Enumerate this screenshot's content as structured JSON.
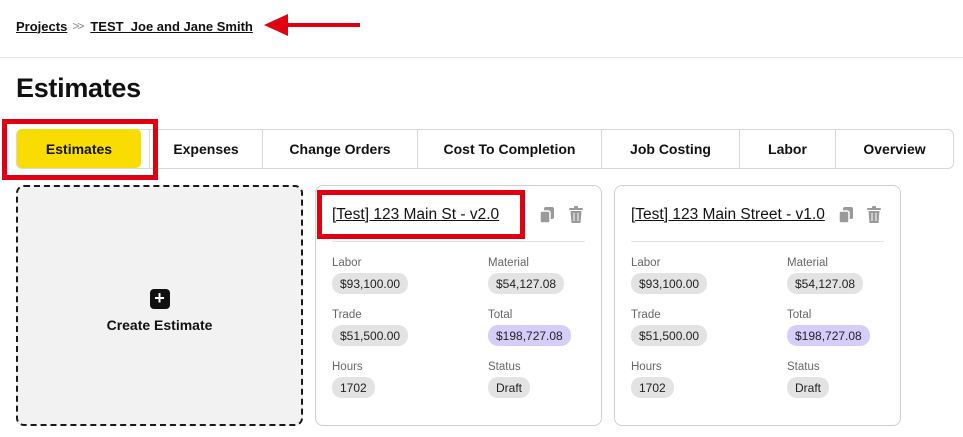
{
  "breadcrumb": {
    "root": "Projects",
    "separator": ">>",
    "current": "TEST_Joe and Jane Smith"
  },
  "page": {
    "title": "Estimates"
  },
  "tabs": [
    {
      "label": "Estimates",
      "active": true
    },
    {
      "label": "Expenses"
    },
    {
      "label": "Change Orders"
    },
    {
      "label": "Cost To Completion"
    },
    {
      "label": "Job Costing"
    },
    {
      "label": "Labor"
    },
    {
      "label": "Overview"
    }
  ],
  "create": {
    "label": "Create Estimate",
    "icon": "plus-icon"
  },
  "estimates": [
    {
      "title": "[Test] 123 Main St - v2.0",
      "labor_label": "Labor",
      "labor": "$93,100.00",
      "material_label": "Material",
      "material": "$54,127.08",
      "trade_label": "Trade",
      "trade": "$51,500.00",
      "total_label": "Total",
      "total": "$198,727.08",
      "hours_label": "Hours",
      "hours": "1702",
      "status_label": "Status",
      "status": "Draft"
    },
    {
      "title": "[Test] 123 Main Street - v1.0",
      "labor_label": "Labor",
      "labor": "$93,100.00",
      "material_label": "Material",
      "material": "$54,127.08",
      "trade_label": "Trade",
      "trade": "$51,500.00",
      "total_label": "Total",
      "total": "$198,727.08",
      "hours_label": "Hours",
      "hours": "1702",
      "status_label": "Status",
      "status": "Draft"
    }
  ],
  "colors": {
    "active_tab": "#f9dd00",
    "total_chip": "#d7cdfb",
    "chip": "#e3e3e3",
    "annotation": "#e00012"
  },
  "icons": [
    "copy-icon",
    "trash-icon",
    "annotation-arrow-icon"
  ]
}
